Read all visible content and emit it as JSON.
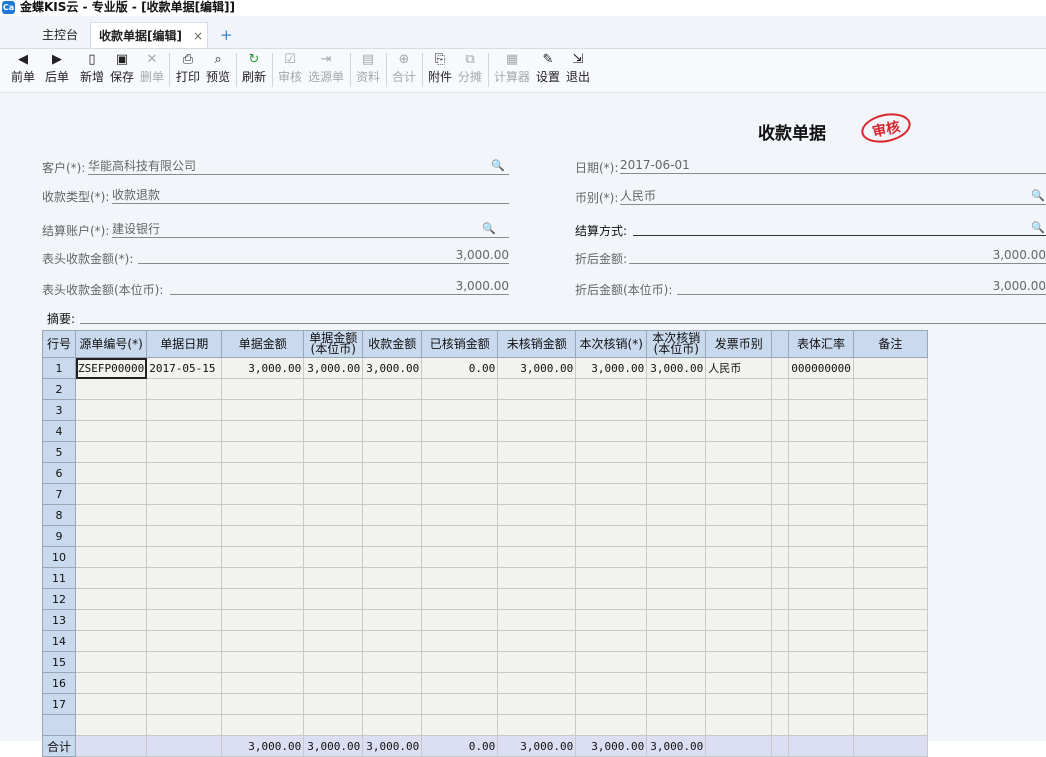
{
  "window": {
    "title": "金蝶KIS云 - 专业版 - [收款单据[编辑]]",
    "logo_text": "Ca"
  },
  "tabs": {
    "home": "主控台",
    "active": "收款单据[编辑]",
    "close": "×",
    "add": "+"
  },
  "toolbar": {
    "prev": "前单",
    "next": "后单",
    "new": "新增",
    "save": "保存",
    "delete": "删单",
    "print": "打印",
    "preview": "预览",
    "refresh": "刷新",
    "audit": "审核",
    "select_source": "选源单",
    "info": "资料",
    "merge": "合计",
    "attachment": "附件",
    "split": "分摊",
    "calculator": "计算器",
    "settings": "设置",
    "exit": "退出"
  },
  "form": {
    "title": "收款单据",
    "stamp": "审核",
    "customer_label": "客户(*):",
    "customer_value": "华能高科技有限公司",
    "type_label": "收款类型(*):",
    "type_value": "收款退款",
    "account_label": "结算账户(*):",
    "account_value": "建设银行",
    "header_amount_label": "表头收款金额(*):",
    "header_amount_value": "3,000.00",
    "header_amount_base_label": "表头收款金额(本位币):",
    "header_amount_base_value": "3,000.00",
    "summary_label": "摘要:",
    "date_label": "日期(*):",
    "date_value": "2017-06-01",
    "currency_label": "币别(*):",
    "currency_value": "人民币",
    "settle_label": "结算方式:",
    "settle_value": "",
    "discount_label": "折后金额:",
    "discount_value": "3,000.00",
    "discount_base_label": "折后金额(本位币):",
    "discount_base_value": "3,000.00"
  },
  "grid": {
    "headers": [
      "行号",
      "源单编号(*)",
      "单据日期",
      "单据金额",
      "单据金额(本位币)",
      "收款金额",
      "已核销金额",
      "未核销金额",
      "本次核销(*)",
      "本次核销(本位币)",
      "发票币别",
      "",
      "表体汇率",
      "备注"
    ],
    "rows": [
      [
        "1",
        "ZSEFP00000",
        "2017-05-15",
        "3,000.00",
        "3,000.00",
        "3,000.00",
        "0.00",
        "3,000.00",
        "3,000.00",
        "3,000.00",
        "人民币",
        "",
        "000000000",
        ""
      ],
      [
        "2",
        "",
        "",
        "",
        "",
        "",
        "",
        "",
        "",
        "",
        "",
        "",
        "",
        ""
      ],
      [
        "3",
        "",
        "",
        "",
        "",
        "",
        "",
        "",
        "",
        "",
        "",
        "",
        "",
        ""
      ],
      [
        "4",
        "",
        "",
        "",
        "",
        "",
        "",
        "",
        "",
        "",
        "",
        "",
        "",
        ""
      ],
      [
        "5",
        "",
        "",
        "",
        "",
        "",
        "",
        "",
        "",
        "",
        "",
        "",
        "",
        ""
      ],
      [
        "6",
        "",
        "",
        "",
        "",
        "",
        "",
        "",
        "",
        "",
        "",
        "",
        "",
        ""
      ],
      [
        "7",
        "",
        "",
        "",
        "",
        "",
        "",
        "",
        "",
        "",
        "",
        "",
        "",
        ""
      ],
      [
        "8",
        "",
        "",
        "",
        "",
        "",
        "",
        "",
        "",
        "",
        "",
        "",
        "",
        ""
      ],
      [
        "9",
        "",
        "",
        "",
        "",
        "",
        "",
        "",
        "",
        "",
        "",
        "",
        "",
        ""
      ],
      [
        "10",
        "",
        "",
        "",
        "",
        "",
        "",
        "",
        "",
        "",
        "",
        "",
        "",
        ""
      ],
      [
        "11",
        "",
        "",
        "",
        "",
        "",
        "",
        "",
        "",
        "",
        "",
        "",
        "",
        ""
      ],
      [
        "12",
        "",
        "",
        "",
        "",
        "",
        "",
        "",
        "",
        "",
        "",
        "",
        "",
        ""
      ],
      [
        "13",
        "",
        "",
        "",
        "",
        "",
        "",
        "",
        "",
        "",
        "",
        "",
        "",
        ""
      ],
      [
        "14",
        "",
        "",
        "",
        "",
        "",
        "",
        "",
        "",
        "",
        "",
        "",
        "",
        ""
      ],
      [
        "15",
        "",
        "",
        "",
        "",
        "",
        "",
        "",
        "",
        "",
        "",
        "",
        "",
        ""
      ],
      [
        "16",
        "",
        "",
        "",
        "",
        "",
        "",
        "",
        "",
        "",
        "",
        "",
        "",
        ""
      ],
      [
        "17",
        "",
        "",
        "",
        "",
        "",
        "",
        "",
        "",
        "",
        "",
        "",
        "",
        ""
      ],
      [
        "",
        "",
        "",
        "",
        "",
        "",
        "",
        "",
        "",
        "",
        "",
        "",
        "",
        ""
      ]
    ],
    "total": [
      "合计",
      "",
      "",
      "3,000.00",
      "3,000.00",
      "3,000.00",
      "0.00",
      "3,000.00",
      "3,000.00",
      "3,000.00",
      "",
      "",
      "",
      ""
    ]
  }
}
